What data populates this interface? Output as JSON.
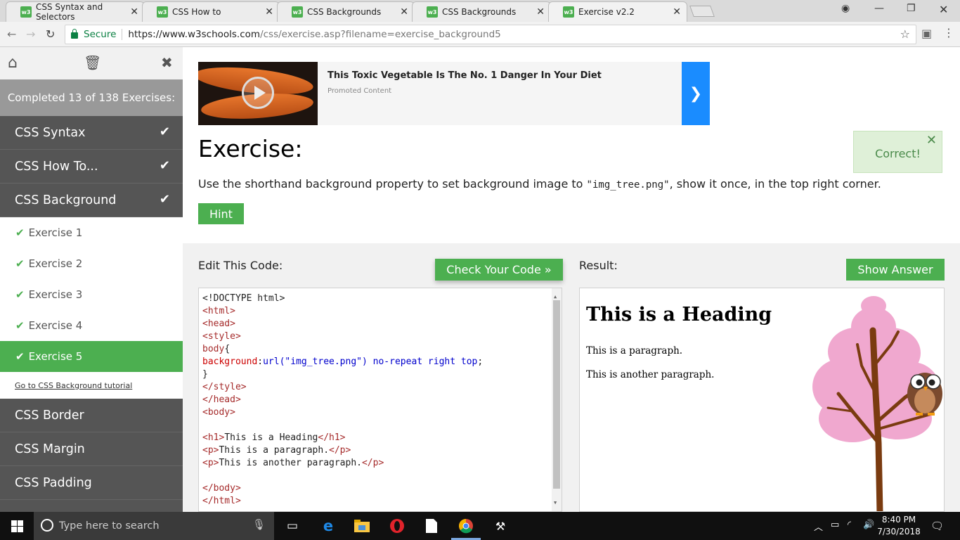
{
  "browser": {
    "tabs": [
      {
        "title": "CSS Syntax and Selectors",
        "active": false
      },
      {
        "title": "CSS How to",
        "active": false
      },
      {
        "title": "CSS Backgrounds",
        "active": false
      },
      {
        "title": "CSS Backgrounds",
        "active": false
      },
      {
        "title": "Exercise v2.2",
        "active": true
      }
    ],
    "favicon_text": "w3",
    "secure_label": "Secure",
    "url_host": "https://www.w3schools.com",
    "url_path": "/css/exercise.asp?filename=exercise_background5"
  },
  "sidebar": {
    "completed": "Completed 13 of 138 Exercises:",
    "sections_done": [
      {
        "label": "CSS Syntax"
      },
      {
        "label": "CSS How To..."
      },
      {
        "label": "CSS Background"
      }
    ],
    "exercises": [
      {
        "label": "Exercise 1",
        "active": false
      },
      {
        "label": "Exercise 2",
        "active": false
      },
      {
        "label": "Exercise 3",
        "active": false
      },
      {
        "label": "Exercise 4",
        "active": false
      },
      {
        "label": "Exercise 5",
        "active": true
      }
    ],
    "tutorial_link": "Go to CSS Background tutorial",
    "sections_rest": [
      {
        "label": "CSS Border"
      },
      {
        "label": "CSS Margin"
      },
      {
        "label": "CSS Padding"
      }
    ]
  },
  "ad": {
    "title": "This Toxic Vegetable Is The No. 1 Danger In Your Diet",
    "promoted": "Promoted Content"
  },
  "toast": {
    "text": "Correct!"
  },
  "exercise": {
    "heading": "Exercise:",
    "instr_pre": "Use the shorthand background property to set background image to ",
    "instr_code": "\"img_tree.png\"",
    "instr_post": ", show it once, in the top right corner.",
    "hint_label": "Hint"
  },
  "editor": {
    "label": "Edit This Code:",
    "check_label": "Check Your Code »",
    "lines": {
      "l1": "<!DOCTYPE html>",
      "l2": "<html>",
      "l3": "<head>",
      "l4": "<style>",
      "l5_sel": "body",
      "l5_brace": "{",
      "l6_prop": "background",
      "l6_colon": ":",
      "l6_url": "url(\"img_tree.png\")",
      "l6_vals": " no-repeat right top",
      "l6_semi": ";",
      "l7": "}",
      "l8": "</style>",
      "l9": "</head>",
      "l10": "<body>",
      "l12_open": "<h1>",
      "l12_text": "This is a Heading",
      "l12_close": "</h1>",
      "l13_open": "<p>",
      "l13_text": "This is a paragraph.",
      "l13_close": "</p>",
      "l14_open": "<p>",
      "l14_text": "This is another paragraph.",
      "l14_close": "</p>",
      "l16": "</body>",
      "l17": "</html>"
    }
  },
  "result": {
    "label": "Result:",
    "show_answer_label": "Show Answer",
    "heading": "This is a Heading",
    "p1": "This is a paragraph.",
    "p2": "This is another paragraph."
  },
  "taskbar": {
    "search_placeholder": "Type here to search",
    "time": "8:40 PM",
    "date": "7/30/2018"
  },
  "colors": {
    "accent_green": "#4caf50",
    "sidebar_dark": "#555555",
    "ad_arrow_blue": "#1a8cff"
  }
}
